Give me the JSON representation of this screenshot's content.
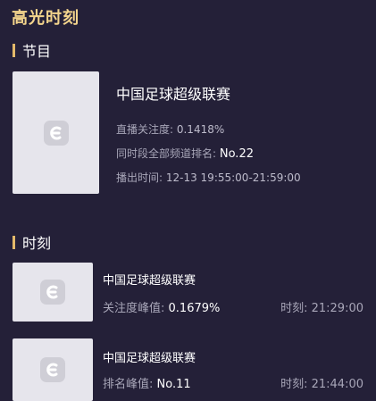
{
  "page": {
    "title": "高光时刻"
  },
  "program_section": {
    "label": "节目",
    "item": {
      "title": "中国足球超级联赛",
      "attention_label": "直播关注度: ",
      "attention_value": "0.1418%",
      "rank_label": "同时段全部频道排名: ",
      "rank_value": "No.22",
      "airtime_label": "播出时间: ",
      "airtime_value": "12-13 19:55:00-21:59:00"
    }
  },
  "moments_section": {
    "label": "时刻",
    "items": [
      {
        "title": "中国足球超级联赛",
        "metric_label": "关注度峰值: ",
        "metric_value": "0.1679%",
        "time_label": "时刻: ",
        "time_value": "21:29:00"
      },
      {
        "title": "中国足球超级联赛",
        "metric_label": "排名峰值: ",
        "metric_value": "No.11",
        "time_label": "时刻: ",
        "time_value": "21:44:00"
      }
    ]
  },
  "icons": {
    "thumbnail": "app-logo-icon"
  },
  "colors": {
    "background": "#242038",
    "accent": "#e3b96a",
    "title": "#f3d48c"
  }
}
